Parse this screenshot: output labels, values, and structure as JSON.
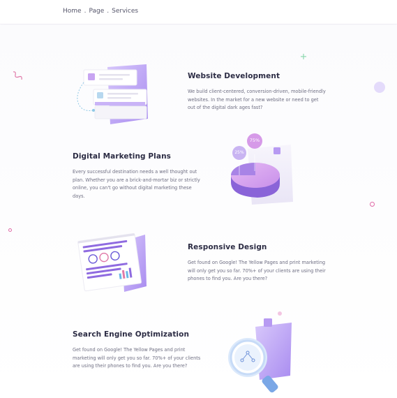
{
  "breadcrumb": {
    "home": "Home",
    "page": "Page",
    "services": "Services",
    "separator": "."
  },
  "sections": [
    {
      "title": "Website Development",
      "description": "We build client-centered, conversion-driven, mobile-friendly websites. In the market for a new website or need to get out of the digital dark ages fast?"
    },
    {
      "title": "Digital Marketing Plans",
      "description": "Every successful destination needs a well thought out plan. Whether you are a brick-and-mortar biz or strictly online, you can't go without digital marketing these days."
    },
    {
      "title": "Responsive Design",
      "description": "Get found on Google! The Yellow Pages and print marketing will only get you so far. 70%+ of your clients are using their phones to find you. Are you there?"
    },
    {
      "title": "Search Engine Optimization",
      "description": "Get found on Google! The Yellow Pages and print marketing will only get you so far. 70%+ of your clients are using their phones to find you. Are you there?"
    }
  ],
  "chart_badges": {
    "big": "75%",
    "small": "25%"
  },
  "icons": {
    "website": "browser-cards-illustration",
    "marketing": "pie-chart-illustration",
    "responsive": "document-report-illustration",
    "seo": "magnifier-illustration"
  },
  "colors": {
    "accent": "#b9a3f5",
    "accent_dark": "#8d6be3",
    "pink": "#d98ae0",
    "title": "#2c2c44",
    "text": "#6e6e82"
  }
}
